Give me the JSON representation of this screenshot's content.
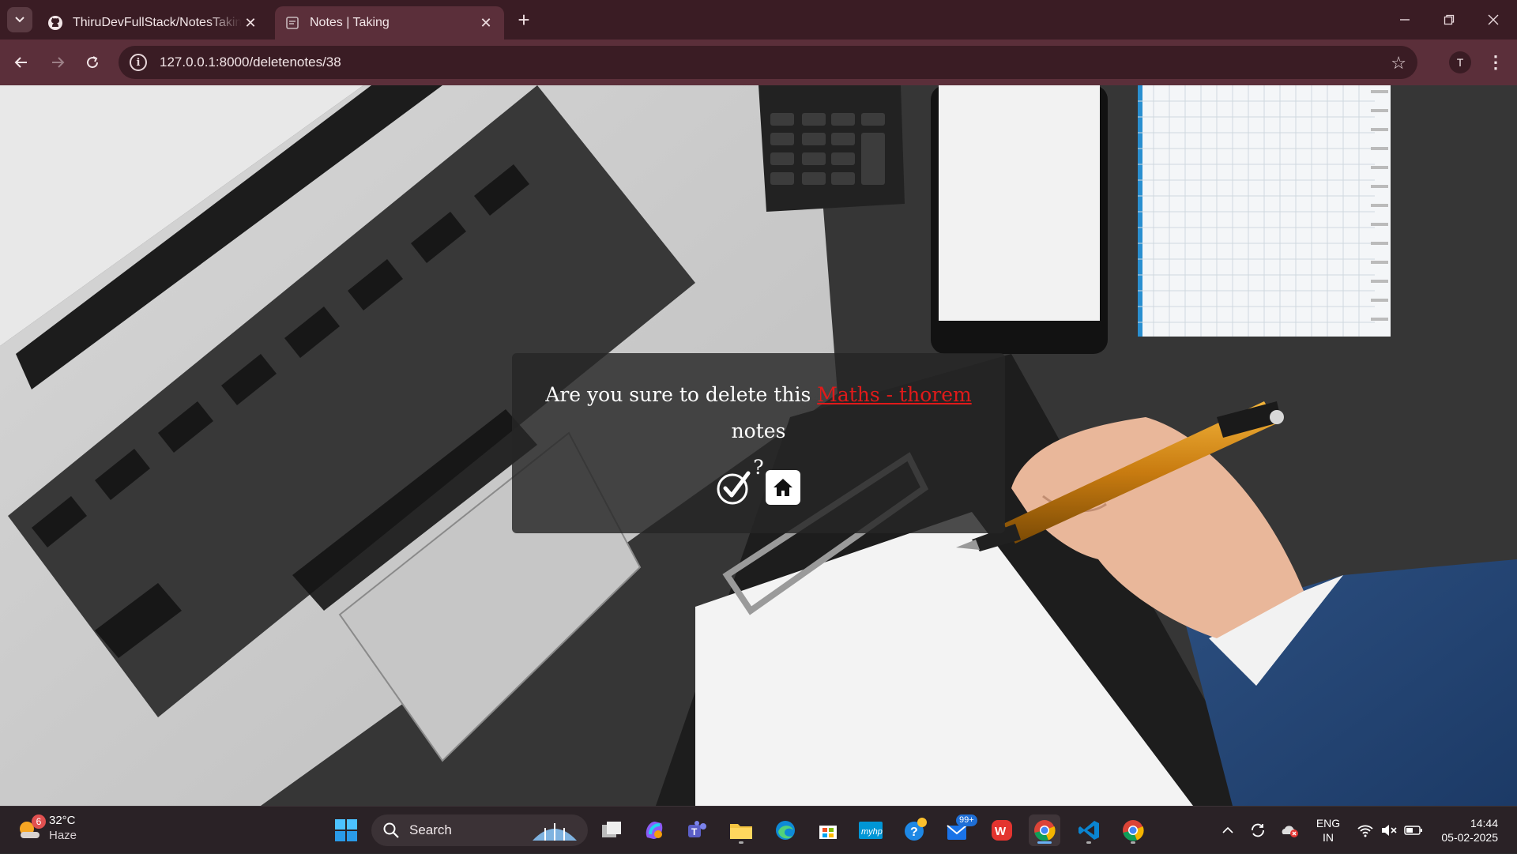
{
  "browser": {
    "tabs": [
      {
        "title": "ThiruDevFullStack/NotesTaking/",
        "favicon": "github-icon"
      },
      {
        "title": "Notes | Taking",
        "favicon": "page-icon"
      }
    ],
    "address": "127.0.0.1:8000/deletenotes/38",
    "profile_initial": "T"
  },
  "dialog": {
    "message_before": "Are you sure to delete this",
    "note_title": "Maths - thorem",
    "message_after": "notes",
    "message_end": "?",
    "confirm_icon": "check-circle-icon",
    "home_icon": "home-icon"
  },
  "taskbar": {
    "weather": {
      "badge": "6",
      "temp": "32°C",
      "condition": "Haze"
    },
    "search_label": "Search",
    "mail_badge": "99+",
    "language": {
      "line1": "ENG",
      "line2": "IN"
    },
    "clock": {
      "time": "14:44",
      "date": "05-02-2025"
    }
  },
  "colors": {
    "titlebar": "#3a1c24",
    "toolbar": "#5b2f3a",
    "note_link": "#e01a1a",
    "taskbar": "#2a2226"
  }
}
